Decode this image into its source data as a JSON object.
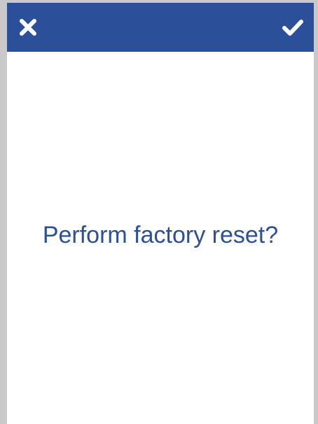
{
  "dialog": {
    "message": "Perform factory reset?"
  },
  "topbar": {
    "background_color": "#2b4f98",
    "cancel_icon": "close-icon",
    "confirm_icon": "checkmark-icon"
  },
  "colors": {
    "accent": "#2b4f98",
    "background": "#ffffff",
    "frame": "#c9c9c9"
  }
}
